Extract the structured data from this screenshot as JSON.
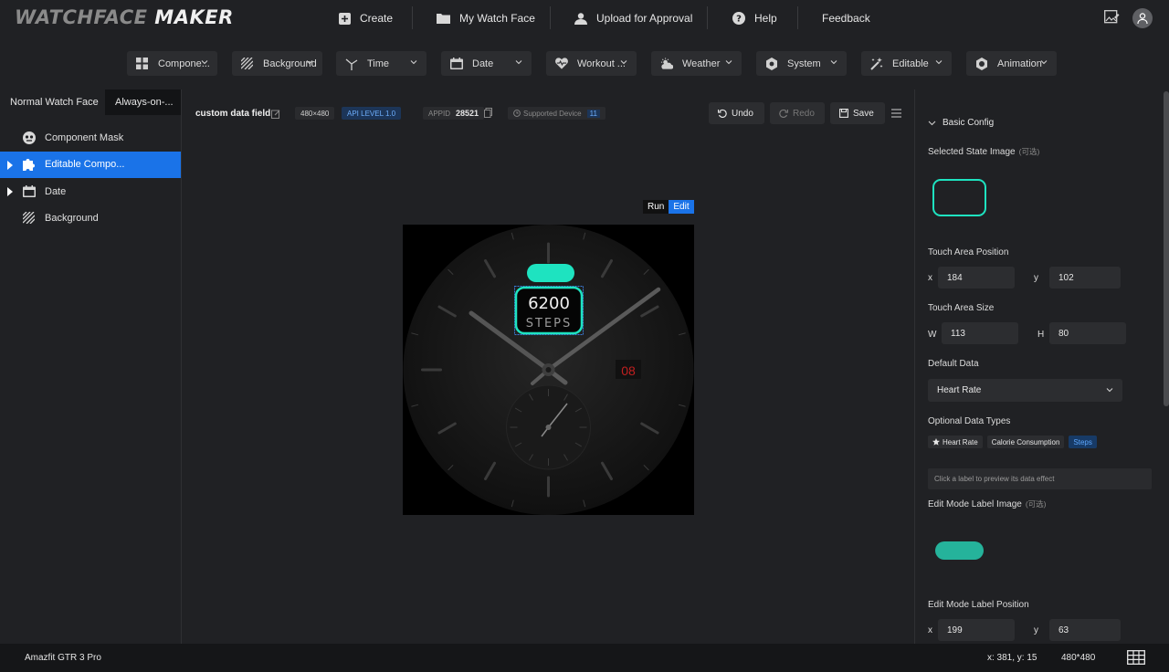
{
  "app": {
    "logo_left": "WATCHFACE",
    "logo_right": "MAKER"
  },
  "nav": {
    "create": "Create",
    "my_watch_face": "My Watch Face",
    "upload": "Upload for Approval",
    "help": "Help",
    "feedback": "Feedback"
  },
  "toolbar": {
    "items": [
      {
        "label": "Compone...",
        "icon": "grid-icon"
      },
      {
        "label": "Background",
        "icon": "stripes-icon"
      },
      {
        "label": "Time",
        "icon": "clock-hands-icon"
      },
      {
        "label": "Date",
        "icon": "calendar-icon"
      },
      {
        "label": "Workout ...",
        "icon": "heart-icon"
      },
      {
        "label": "Weather",
        "icon": "weather-icon"
      },
      {
        "label": "System",
        "icon": "gear-icon"
      },
      {
        "label": "Editable",
        "icon": "wand-icon"
      },
      {
        "label": "Animation",
        "icon": "animation-icon"
      }
    ]
  },
  "left": {
    "tabs": [
      "Normal Watch Face",
      "Always-on-..."
    ],
    "tree": [
      {
        "label": "Component Mask",
        "icon": "mask-icon",
        "expandable": false,
        "selected": false
      },
      {
        "label": "Editable Compo...",
        "icon": "puzzle-icon",
        "expandable": true,
        "selected": true
      },
      {
        "label": "Date",
        "icon": "calendar-icon",
        "expandable": true,
        "selected": false
      },
      {
        "label": "Background",
        "icon": "stripes-icon",
        "expandable": false,
        "selected": false
      }
    ]
  },
  "canvas": {
    "project_name": "custom data field",
    "resolution": "480×480",
    "api_level": "API LEVEL 1.0",
    "appid_label": "APPID",
    "appid": "28521",
    "supported_device_label": "Supported Device",
    "supported_device_count": "11",
    "undo": "Undo",
    "redo": "Redo",
    "save": "Save",
    "run": "Run",
    "edit": "Edit"
  },
  "watch": {
    "steps_value": "6200",
    "steps_label": "STEPS",
    "date_value": "08",
    "accent": "#1ee3c0"
  },
  "right": {
    "section": "Basic Config",
    "selected_state_image": "Selected State Image",
    "optional": "(可选)",
    "touch_area_position": "Touch Area Position",
    "touch_x_label": "x",
    "touch_x": "184",
    "touch_y_label": "y",
    "touch_y": "102",
    "touch_area_size": "Touch Area Size",
    "w_label": "W",
    "w": "113",
    "h_label": "H",
    "h": "80",
    "default_data": "Default Data",
    "default_value": "Heart Rate",
    "optional_data_types": "Optional Data Types",
    "tags": [
      "Heart Rate",
      "Calorie Consumption",
      "Steps"
    ],
    "hint": "Click a label to preview its data effect",
    "edit_mode_label_image": "Edit Mode Label Image",
    "edit_mode_label_position": "Edit Mode Label Position",
    "label_x_label": "x",
    "label_x": "199",
    "label_y_label": "y",
    "label_y": "63"
  },
  "status": {
    "device": "Amazfit GTR 3 Pro",
    "coords": "x: 381, y: 15",
    "size": "480*480"
  }
}
